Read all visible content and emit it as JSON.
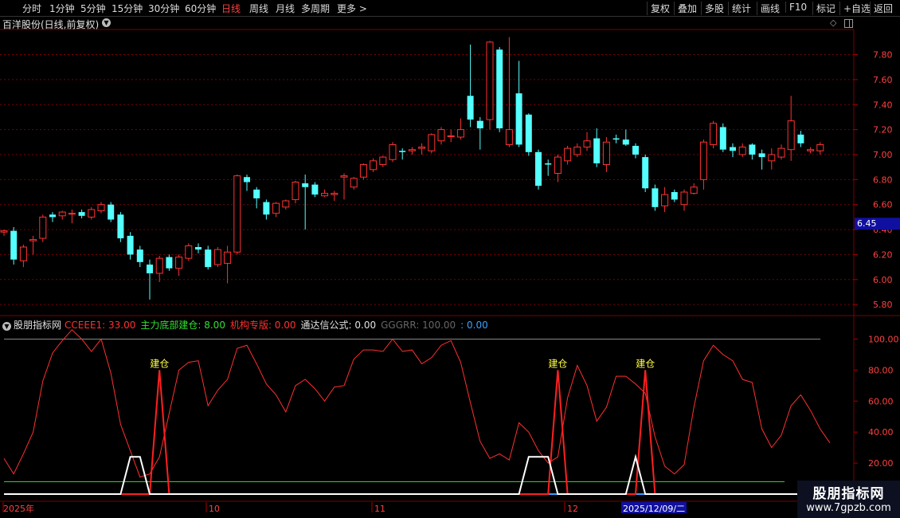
{
  "toolbar": {
    "periods": [
      "分时",
      "1分钟",
      "5分钟",
      "15分钟",
      "30分钟",
      "60分钟",
      "日线",
      "周线",
      "月线",
      "多周期",
      "更多 >"
    ],
    "active_period": "日线",
    "right_buttons": [
      "复权",
      "叠加",
      "多股",
      "统计",
      "画线",
      "F10",
      "标记",
      "+自选",
      "返回"
    ]
  },
  "stock": {
    "title": "百洋股份(日线,前复权)"
  },
  "price_axis": {
    "ticks": [
      "7.80",
      "7.60",
      "7.40",
      "7.20",
      "7.00",
      "6.80",
      "6.60",
      "6.40",
      "6.20",
      "6.00",
      "5.80"
    ],
    "current_price": "6.45"
  },
  "indicator": {
    "name": "股朋指标网",
    "items": [
      {
        "label": "CCEEE1: 33.00",
        "color": "#ff3030"
      },
      {
        "label": "主力底部建仓: 8.00",
        "color": "#30e030"
      },
      {
        "label": "机构专版: 0.00",
        "color": "#ff3030"
      },
      {
        "label": "通达信公式: 0.00",
        "color": "#e0e0e0"
      },
      {
        "label": "GGGRR: 100.00",
        "color": "#666666"
      },
      {
        "label": ": 0.00",
        "color": "#3aa0ff"
      }
    ],
    "axis_ticks": [
      "100.00",
      "80.00",
      "60.00",
      "40.00",
      "20.00"
    ],
    "signal_label": "建仓"
  },
  "date_axis": {
    "labels": [
      "2025年",
      "10",
      "11",
      "12"
    ],
    "cursor_date": "2025/12/09/二"
  },
  "watermark": {
    "line1": "股朋指标网",
    "line2": "www.7gpzb.com"
  },
  "colors": {
    "up": "#ff3232",
    "down": "#54ffff",
    "grid": "#7a0000"
  },
  "chart_data": [
    {
      "type": "candlestick",
      "title": "百洋股份(日线,前复权)",
      "ylim": [
        5.75,
        7.95
      ],
      "candles": [
        {
          "o": 6.38,
          "c": 6.39,
          "h": 6.4,
          "l": 6.35
        },
        {
          "o": 6.39,
          "c": 6.16,
          "h": 6.42,
          "l": 6.12
        },
        {
          "o": 6.15,
          "c": 6.26,
          "h": 6.28,
          "l": 6.1
        },
        {
          "o": 6.31,
          "c": 6.32,
          "h": 6.35,
          "l": 6.2
        },
        {
          "o": 6.33,
          "c": 6.5,
          "h": 6.52,
          "l": 6.3
        },
        {
          "o": 6.52,
          "c": 6.5,
          "h": 6.54,
          "l": 6.46
        },
        {
          "o": 6.51,
          "c": 6.54,
          "h": 6.55,
          "l": 6.48
        },
        {
          "o": 6.53,
          "c": 6.53,
          "h": 6.56,
          "l": 6.45
        },
        {
          "o": 6.54,
          "c": 6.51,
          "h": 6.56,
          "l": 6.49
        },
        {
          "o": 6.5,
          "c": 6.56,
          "h": 6.58,
          "l": 6.48
        },
        {
          "o": 6.55,
          "c": 6.6,
          "h": 6.62,
          "l": 6.53
        },
        {
          "o": 6.6,
          "c": 6.48,
          "h": 6.62,
          "l": 6.46
        },
        {
          "o": 6.52,
          "c": 6.33,
          "h": 6.54,
          "l": 6.3
        },
        {
          "o": 6.35,
          "c": 6.2,
          "h": 6.38,
          "l": 6.16
        },
        {
          "o": 6.24,
          "c": 6.14,
          "h": 6.27,
          "l": 6.1
        },
        {
          "o": 6.12,
          "c": 6.05,
          "h": 6.16,
          "l": 5.84
        },
        {
          "o": 6.05,
          "c": 6.17,
          "h": 6.19,
          "l": 5.98
        },
        {
          "o": 6.18,
          "c": 6.09,
          "h": 6.2,
          "l": 6.07
        },
        {
          "o": 6.09,
          "c": 6.18,
          "h": 6.2,
          "l": 6.03
        },
        {
          "o": 6.17,
          "c": 6.27,
          "h": 6.29,
          "l": 6.15
        },
        {
          "o": 6.26,
          "c": 6.24,
          "h": 6.29,
          "l": 6.21
        },
        {
          "o": 6.24,
          "c": 6.1,
          "h": 6.27,
          "l": 6.08
        },
        {
          "o": 6.12,
          "c": 6.24,
          "h": 6.26,
          "l": 6.1
        },
        {
          "o": 6.13,
          "c": 6.22,
          "h": 6.27,
          "l": 5.97
        },
        {
          "o": 6.22,
          "c": 6.83,
          "h": 6.84,
          "l": 6.2
        },
        {
          "o": 6.82,
          "c": 6.78,
          "h": 6.84,
          "l": 6.71
        },
        {
          "o": 6.72,
          "c": 6.65,
          "h": 6.74,
          "l": 6.57
        },
        {
          "o": 6.62,
          "c": 6.52,
          "h": 6.64,
          "l": 6.48
        },
        {
          "o": 6.53,
          "c": 6.61,
          "h": 6.62,
          "l": 6.5
        },
        {
          "o": 6.58,
          "c": 6.63,
          "h": 6.64,
          "l": 6.56
        },
        {
          "o": 6.64,
          "c": 6.78,
          "h": 6.79,
          "l": 6.61
        },
        {
          "o": 6.77,
          "c": 6.74,
          "h": 6.84,
          "l": 6.4
        },
        {
          "o": 6.76,
          "c": 6.68,
          "h": 6.78,
          "l": 6.66
        },
        {
          "o": 6.67,
          "c": 6.69,
          "h": 6.72,
          "l": 6.66
        },
        {
          "o": 6.68,
          "c": 6.69,
          "h": 6.71,
          "l": 6.63
        },
        {
          "o": 6.82,
          "c": 6.83,
          "h": 6.85,
          "l": 6.64
        },
        {
          "o": 6.74,
          "c": 6.81,
          "h": 6.82,
          "l": 6.72
        },
        {
          "o": 6.82,
          "c": 6.92,
          "h": 6.93,
          "l": 6.8
        },
        {
          "o": 6.88,
          "c": 6.95,
          "h": 6.97,
          "l": 6.86
        },
        {
          "o": 6.92,
          "c": 6.98,
          "h": 6.99,
          "l": 6.9
        },
        {
          "o": 6.96,
          "c": 7.08,
          "h": 7.1,
          "l": 6.94
        },
        {
          "o": 7.03,
          "c": 7.02,
          "h": 7.05,
          "l": 6.96
        },
        {
          "o": 7.03,
          "c": 7.04,
          "h": 7.06,
          "l": 7.0
        },
        {
          "o": 7.05,
          "c": 7.06,
          "h": 7.09,
          "l": 7.0
        },
        {
          "o": 7.03,
          "c": 7.16,
          "h": 7.17,
          "l": 7.01
        },
        {
          "o": 7.11,
          "c": 7.2,
          "h": 7.22,
          "l": 7.08
        },
        {
          "o": 7.15,
          "c": 7.15,
          "h": 7.2,
          "l": 7.1
        },
        {
          "o": 7.14,
          "c": 7.2,
          "h": 7.29,
          "l": 7.12
        },
        {
          "o": 7.47,
          "c": 7.28,
          "h": 7.88,
          "l": 7.22
        },
        {
          "o": 7.27,
          "c": 7.21,
          "h": 7.3,
          "l": 7.04
        },
        {
          "o": 7.28,
          "c": 7.9,
          "h": 7.91,
          "l": 7.2
        },
        {
          "o": 7.84,
          "c": 7.21,
          "h": 7.86,
          "l": 7.18
        },
        {
          "o": 7.08,
          "c": 7.2,
          "h": 7.94,
          "l": 7.06
        },
        {
          "o": 7.49,
          "c": 7.08,
          "h": 7.75,
          "l": 7.06
        },
        {
          "o": 7.32,
          "c": 7.02,
          "h": 7.33,
          "l": 6.99
        },
        {
          "o": 7.02,
          "c": 6.75,
          "h": 7.04,
          "l": 6.72
        },
        {
          "o": 6.93,
          "c": 6.92,
          "h": 6.96,
          "l": 6.83
        },
        {
          "o": 6.85,
          "c": 6.98,
          "h": 7.0,
          "l": 6.78
        },
        {
          "o": 6.95,
          "c": 7.05,
          "h": 7.07,
          "l": 6.92
        },
        {
          "o": 7.0,
          "c": 7.06,
          "h": 7.09,
          "l": 6.98
        },
        {
          "o": 7.06,
          "c": 7.11,
          "h": 7.18,
          "l": 7.03
        },
        {
          "o": 7.13,
          "c": 6.93,
          "h": 7.21,
          "l": 6.9
        },
        {
          "o": 6.92,
          "c": 7.1,
          "h": 7.14,
          "l": 6.86
        },
        {
          "o": 7.13,
          "c": 7.12,
          "h": 7.16,
          "l": 7.09
        },
        {
          "o": 7.12,
          "c": 7.08,
          "h": 7.2,
          "l": 7.07
        },
        {
          "o": 7.07,
          "c": 7.0,
          "h": 7.09,
          "l": 6.97
        },
        {
          "o": 6.98,
          "c": 6.73,
          "h": 7.0,
          "l": 6.7
        },
        {
          "o": 6.73,
          "c": 6.58,
          "h": 6.76,
          "l": 6.55
        },
        {
          "o": 6.59,
          "c": 6.68,
          "h": 6.74,
          "l": 6.54
        },
        {
          "o": 6.7,
          "c": 6.64,
          "h": 6.72,
          "l": 6.62
        },
        {
          "o": 6.6,
          "c": 6.7,
          "h": 6.72,
          "l": 6.55
        },
        {
          "o": 6.69,
          "c": 6.74,
          "h": 6.77,
          "l": 6.68
        },
        {
          "o": 6.8,
          "c": 7.1,
          "h": 7.12,
          "l": 6.72
        },
        {
          "o": 7.08,
          "c": 7.25,
          "h": 7.27,
          "l": 7.05
        },
        {
          "o": 7.22,
          "c": 7.04,
          "h": 7.25,
          "l": 7.02
        },
        {
          "o": 7.06,
          "c": 7.03,
          "h": 7.09,
          "l": 6.98
        },
        {
          "o": 7.0,
          "c": 7.06,
          "h": 7.09,
          "l": 6.98
        },
        {
          "o": 7.08,
          "c": 7.0,
          "h": 7.09,
          "l": 6.96
        },
        {
          "o": 7.01,
          "c": 6.98,
          "h": 7.04,
          "l": 6.88
        },
        {
          "o": 6.95,
          "c": 7.0,
          "h": 7.05,
          "l": 6.88
        },
        {
          "o": 6.98,
          "c": 7.05,
          "h": 7.08,
          "l": 6.96
        },
        {
          "o": 7.04,
          "c": 7.27,
          "h": 7.47,
          "l": 6.95
        },
        {
          "o": 7.16,
          "c": 7.09,
          "h": 7.19,
          "l": 7.06
        },
        {
          "o": 7.03,
          "c": 7.04,
          "h": 7.06,
          "l": 7.01
        },
        {
          "o": 7.03,
          "c": 7.08,
          "h": 7.1,
          "l": 7.0
        }
      ]
    },
    {
      "type": "line",
      "ylim": [
        0,
        110
      ],
      "series": [
        {
          "name": "CCEEE1",
          "color": "#ff3030",
          "values": [
            23,
            13,
            26,
            40,
            73,
            91,
            99,
            106,
            100,
            92,
            100,
            78,
            45,
            28,
            11,
            13,
            24,
            52,
            80,
            85,
            86,
            57,
            67,
            74,
            94,
            96,
            84,
            71,
            64,
            53,
            70,
            74,
            68,
            60,
            69,
            70,
            87,
            93,
            93,
            92,
            100,
            92,
            93,
            84,
            88,
            96,
            99,
            85,
            59,
            34,
            23,
            26,
            22,
            46,
            40,
            28,
            20,
            24,
            62,
            83,
            70,
            47,
            56,
            76,
            76,
            71,
            65,
            37,
            18,
            13,
            19,
            56,
            86,
            96,
            90,
            86,
            74,
            72,
            42,
            30,
            38,
            57,
            64,
            54,
            42,
            33
          ]
        },
        {
          "name": "主力底部建仓",
          "color": "#ff2020",
          "values": [
            0,
            0,
            0,
            0,
            0,
            0,
            0,
            0,
            0,
            0,
            0,
            0,
            0,
            0,
            0,
            0,
            80,
            0,
            0,
            0,
            0,
            0,
            0,
            0,
            0,
            0,
            0,
            0,
            0,
            0,
            0,
            0,
            0,
            0,
            0,
            0,
            0,
            0,
            0,
            0,
            0,
            0,
            0,
            0,
            0,
            0,
            0,
            0,
            0,
            0,
            0,
            0,
            0,
            0,
            0,
            0,
            0,
            80,
            0,
            0,
            0,
            0,
            0,
            0,
            0,
            0,
            80,
            0,
            0,
            0,
            0,
            0,
            0,
            0,
            0,
            0,
            0,
            0,
            0,
            0,
            0,
            0,
            0,
            0,
            0,
            0
          ]
        },
        {
          "name": "通达信公式",
          "color": "#ffffff",
          "values": [
            0,
            0,
            0,
            0,
            0,
            0,
            0,
            0,
            0,
            0,
            0,
            0,
            0,
            24,
            24,
            0,
            0,
            0,
            0,
            0,
            0,
            0,
            0,
            0,
            0,
            0,
            0,
            0,
            0,
            0,
            0,
            0,
            0,
            0,
            0,
            0,
            0,
            0,
            0,
            0,
            0,
            0,
            0,
            0,
            0,
            0,
            0,
            0,
            0,
            0,
            0,
            0,
            0,
            0,
            24,
            24,
            24,
            0,
            0,
            0,
            0,
            0,
            0,
            0,
            0,
            24,
            0,
            0,
            0,
            0,
            0,
            0,
            0,
            0,
            0,
            0,
            0,
            0,
            0,
            0,
            0,
            0,
            0,
            0,
            0,
            0
          ]
        }
      ],
      "reference_lines": [
        {
          "value": 100,
          "color": "#888888"
        },
        {
          "value": 8,
          "color": "#30e030"
        },
        {
          "value": 0,
          "color": "#3aa0ff"
        }
      ]
    }
  ]
}
